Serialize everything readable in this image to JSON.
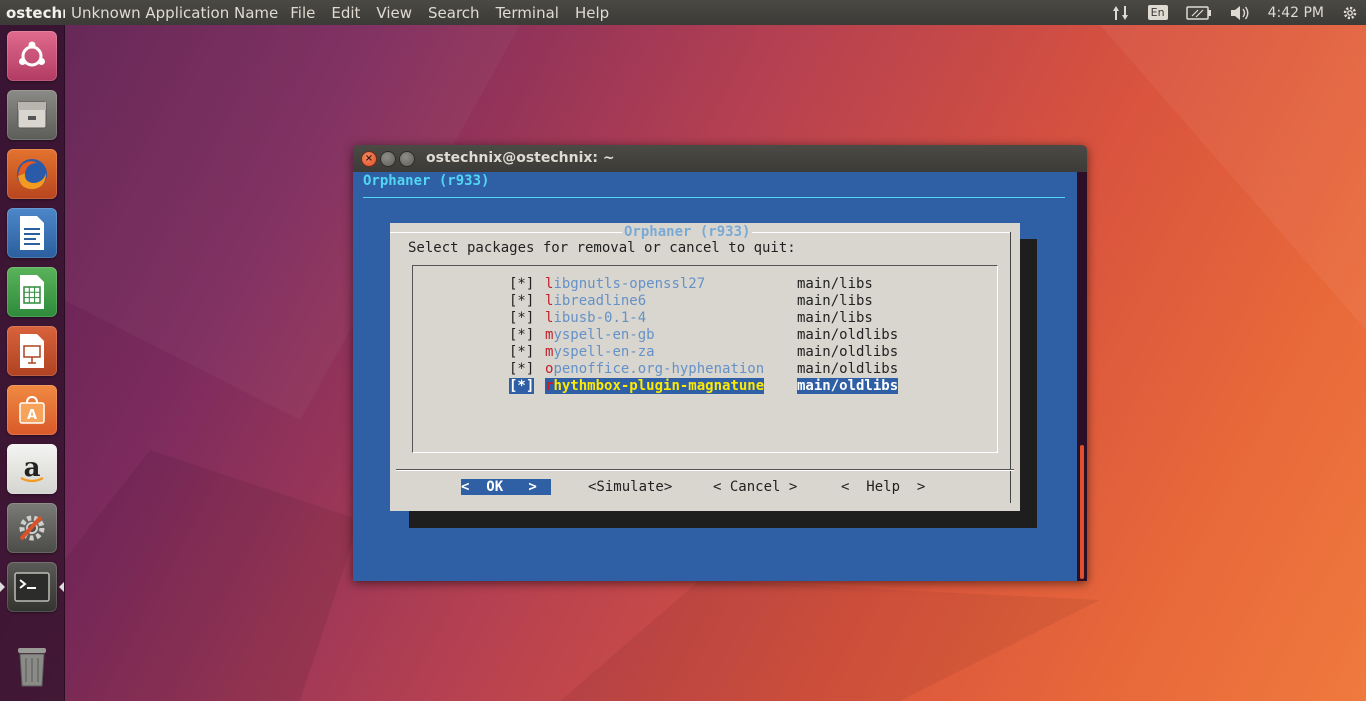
{
  "top_panel": {
    "app_badge": "ostechni",
    "app_name": "Unknown Application Name",
    "menu": [
      "File",
      "Edit",
      "View",
      "Search",
      "Terminal",
      "Help"
    ],
    "language": "En",
    "clock": "4:42 PM",
    "icons": [
      "network-transfer-icon",
      "battery-icon",
      "volume-icon",
      "gear-icon"
    ]
  },
  "launcher": {
    "items": [
      "ubuntu-dash",
      "files",
      "firefox",
      "libreoffice-writer",
      "libreoffice-calc",
      "libreoffice-impress",
      "ubuntu-software",
      "amazon",
      "system-settings",
      "terminal",
      "trash"
    ]
  },
  "window": {
    "title": "ostechnix@ostechnix: ~"
  },
  "terminal": {
    "background_title": "Orphaner (r933)",
    "dialog": {
      "title": "Orphaner (r933)",
      "prompt": "Select packages for removal or cancel to quit:",
      "packages": [
        {
          "check": "[*]",
          "hot": "l",
          "rest": "ibgnutls-openssl27",
          "section": "main/libs"
        },
        {
          "check": "[*]",
          "hot": "l",
          "rest": "ibreadline6",
          "section": "main/libs"
        },
        {
          "check": "[*]",
          "hot": "l",
          "rest": "ibusb-0.1-4",
          "section": "main/libs"
        },
        {
          "check": "[*]",
          "hot": "m",
          "rest": "yspell-en-gb",
          "section": "main/oldlibs"
        },
        {
          "check": "[*]",
          "hot": "m",
          "rest": "yspell-en-za",
          "section": "main/oldlibs"
        },
        {
          "check": "[*]",
          "hot": "o",
          "rest": "penoffice.org-hyphenation",
          "section": "main/oldlibs"
        },
        {
          "check": "[*]",
          "hot": "r",
          "rest": "hythmbox-plugin-magnatune",
          "section": "main/oldlibs",
          "selected": true
        }
      ],
      "buttons": {
        "ok": "<  OK   >",
        "simulate": "<Simulate>",
        "cancel": "< Cancel >",
        "help": "<  Help  >"
      }
    }
  },
  "colors": {
    "terminal_bg": "#2f5fa5",
    "dialog_bg": "#d8d6cf",
    "title_cyan": "#52d6f2",
    "hotkey_red": "#c0202a",
    "package_blue": "#6591c7",
    "selected_yellow": "#ffea00",
    "ubuntu_orange": "#e0502a"
  }
}
